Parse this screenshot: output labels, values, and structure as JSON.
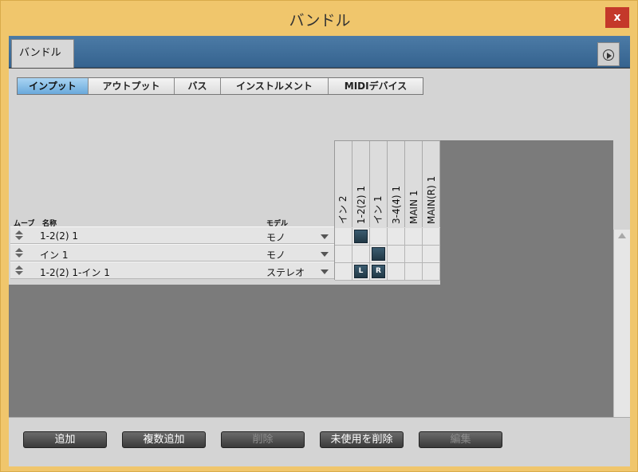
{
  "window": {
    "title": "バンドル",
    "close_label": "x"
  },
  "tabs": {
    "active": "バンドル"
  },
  "subtabs": [
    {
      "label": "インプット",
      "active": true
    },
    {
      "label": "アウトプット",
      "active": false
    },
    {
      "label": "バス",
      "active": false
    },
    {
      "label": "インストルメント",
      "active": false
    },
    {
      "label": "MIDIデバイス",
      "active": false
    }
  ],
  "table": {
    "headers": {
      "move": "ムーブ",
      "name": "名称",
      "mode": "モデル"
    },
    "rows": [
      {
        "name": "1-2(2) 1",
        "mode": "モノ"
      },
      {
        "name": "イン 1",
        "mode": "モノ"
      },
      {
        "name": "1-2(2) 1-イン 1",
        "mode": "ステレオ"
      }
    ]
  },
  "matrix": {
    "columns": [
      "イン 2",
      "1-2(2) 1",
      "イン 1",
      "3-4(4) 1",
      "MAIN 1",
      "MAIN(R) 1"
    ],
    "assignments": [
      {
        "row": 0,
        "col": 1,
        "label": ""
      },
      {
        "row": 1,
        "col": 2,
        "label": ""
      },
      {
        "row": 2,
        "col": 1,
        "label": "L"
      },
      {
        "row": 2,
        "col": 2,
        "label": "R"
      }
    ]
  },
  "footer": {
    "buttons": [
      {
        "label": "追加",
        "enabled": true
      },
      {
        "label": "複数追加",
        "enabled": true
      },
      {
        "label": "削除",
        "enabled": false
      },
      {
        "label": "未使用を削除",
        "enabled": true
      },
      {
        "label": "編集",
        "enabled": false
      }
    ]
  },
  "colors": {
    "accent": "#6aa9db",
    "titlebar": "#f0c66c",
    "close": "#c4382a",
    "tabstrip": "#35638f"
  }
}
